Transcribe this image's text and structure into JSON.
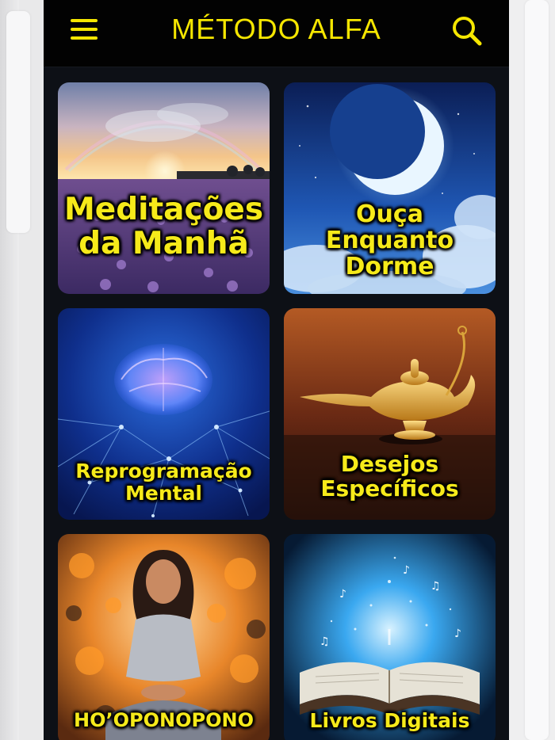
{
  "header": {
    "title": "MÉTODO ALFA",
    "menu_icon": "hamburger-menu-icon",
    "search_icon": "search-icon"
  },
  "colors": {
    "accent": "#f5e600",
    "header_bg": "#020202",
    "app_bg": "#0d1016"
  },
  "tiles": [
    {
      "label_lines": [
        "Meditações",
        "da Manhã"
      ],
      "image": "lavender-field-sunrise-rainbow"
    },
    {
      "label_lines": [
        "Ouça",
        "Enquanto",
        "Dorme"
      ],
      "image": "crescent-moon-night-sky"
    },
    {
      "label_lines": [
        "Reprogramação",
        "Mental"
      ],
      "image": "glowing-neural-brain"
    },
    {
      "label_lines": [
        "Desejos",
        "Específicos"
      ],
      "image": "golden-magic-lamp"
    },
    {
      "label_lines": [
        "HO’OPONOPONO"
      ],
      "image": "meditating-woman-autumn-leaves"
    },
    {
      "label_lines": [
        "Livros Digitais"
      ],
      "image": "open-book-musical-notes"
    }
  ]
}
